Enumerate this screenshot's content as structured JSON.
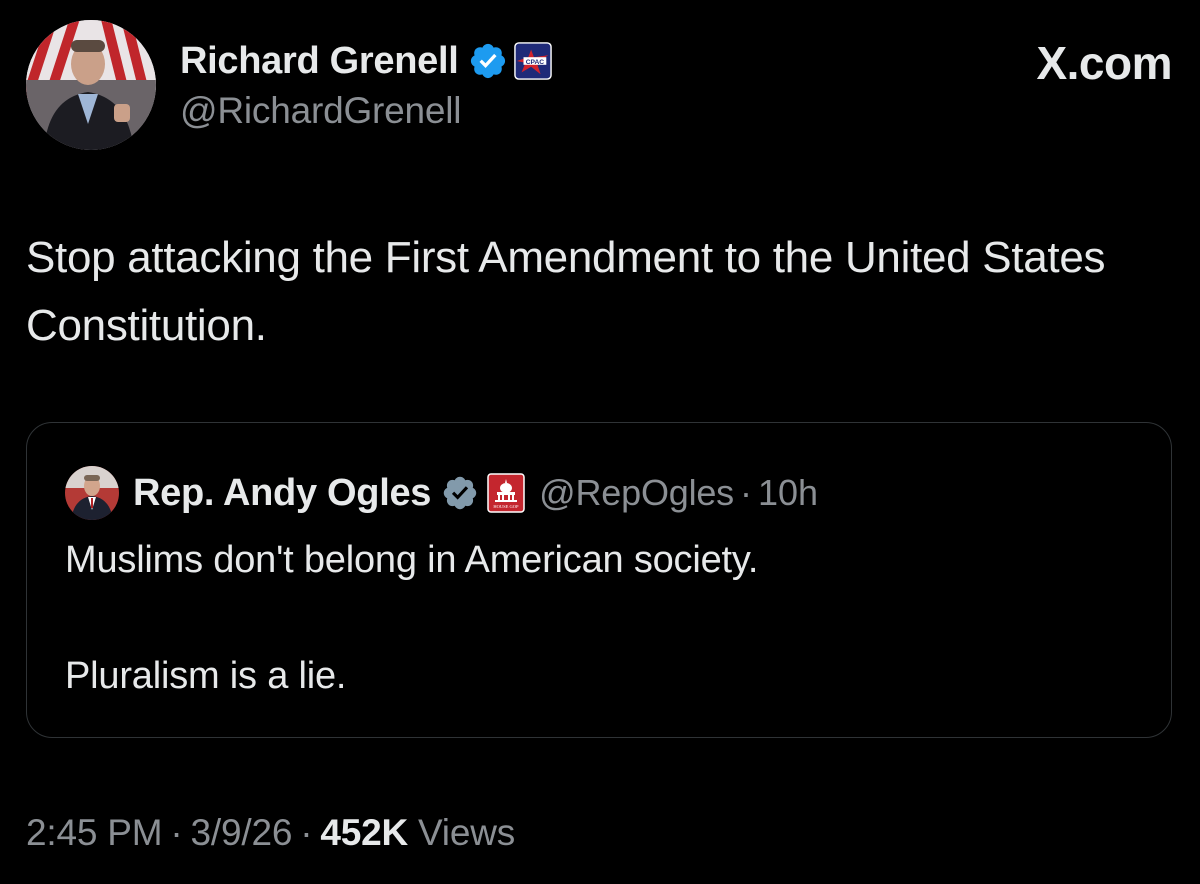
{
  "author": {
    "display_name": "Richard Grenell",
    "handle": "@RichardGrenell",
    "affiliation_badge_text": "CPAC"
  },
  "brand": {
    "label": "X.com"
  },
  "tweet": {
    "text": "Stop attacking the First Amendment to the United States Constitution."
  },
  "quoted_tweet": {
    "display_name": "Rep. Andy Ogles",
    "handle": "@RepOgles",
    "separator": "·",
    "time": "10h",
    "affiliation_badge_text": "HOUSE GOP",
    "line1": "Muslims don't belong in American society.",
    "line2": "Pluralism is a lie."
  },
  "meta": {
    "time": "2:45 PM",
    "separator": "·",
    "date": "3/9/26",
    "views_count": "452K",
    "views_label": "Views"
  },
  "colors": {
    "background": "#000000",
    "primary_text": "#e7e9ea",
    "secondary_text": "#8b8f94",
    "verified_blue": "#1d9bf0",
    "verified_gray": "#829aab",
    "quote_border": "#2f3336"
  }
}
